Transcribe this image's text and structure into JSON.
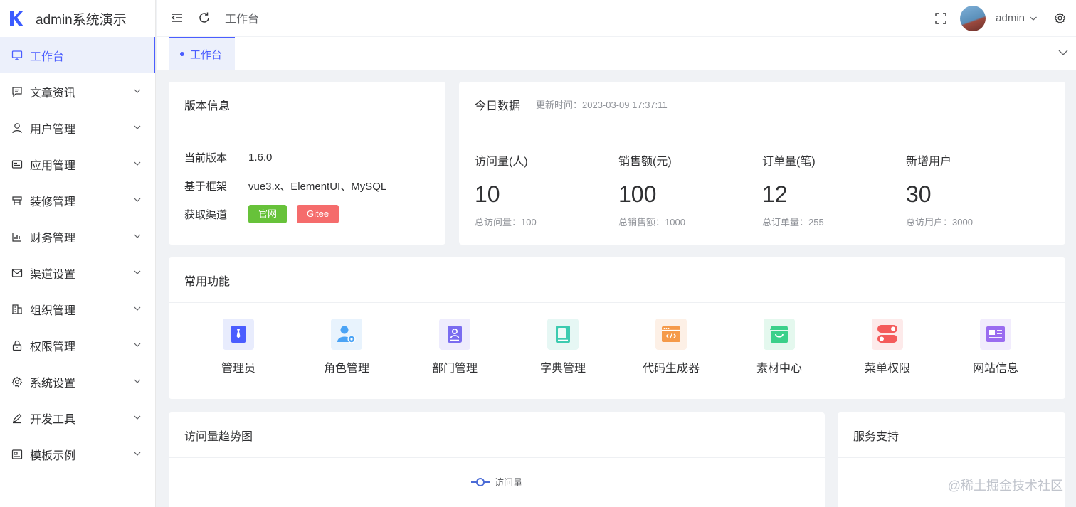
{
  "app": {
    "title": "admin系统演示"
  },
  "sidebar": {
    "items": [
      {
        "label": "工作台",
        "icon": "monitor-icon",
        "active": true
      },
      {
        "label": "文章资讯",
        "icon": "message-icon"
      },
      {
        "label": "用户管理",
        "icon": "user-icon"
      },
      {
        "label": "应用管理",
        "icon": "app-icon"
      },
      {
        "label": "装修管理",
        "icon": "decorate-icon"
      },
      {
        "label": "财务管理",
        "icon": "chart-icon"
      },
      {
        "label": "渠道设置",
        "icon": "mail-icon"
      },
      {
        "label": "组织管理",
        "icon": "building-icon"
      },
      {
        "label": "权限管理",
        "icon": "lock-icon"
      },
      {
        "label": "系统设置",
        "icon": "gear-icon"
      },
      {
        "label": "开发工具",
        "icon": "pen-icon"
      },
      {
        "label": "模板示例",
        "icon": "template-icon"
      }
    ]
  },
  "header": {
    "breadcrumb": "工作台",
    "user": "admin"
  },
  "tabs": [
    {
      "label": "工作台"
    }
  ],
  "version": {
    "title": "版本信息",
    "rows": [
      {
        "k": "当前版本",
        "v": "1.6.0"
      },
      {
        "k": "基于框架",
        "v": "vue3.x、ElementUI、MySQL"
      },
      {
        "k": "获取渠道"
      }
    ],
    "btn_official": "官网",
    "btn_gitee": "Gitee"
  },
  "today": {
    "title": "今日数据",
    "updated": "更新时间：2023-03-09 17:37:11",
    "stats": [
      {
        "label": "访问量(人)",
        "value": "10",
        "sub": "总访问量：100"
      },
      {
        "label": "销售额(元)",
        "value": "100",
        "sub": "总销售额：1000"
      },
      {
        "label": "订单量(笔)",
        "value": "12",
        "sub": "总订单量：255"
      },
      {
        "label": "新增用户",
        "value": "30",
        "sub": "总访用户：3000"
      }
    ]
  },
  "functions": {
    "title": "常用功能",
    "items": [
      {
        "label": "管理员",
        "icon": "admin-icon",
        "bg": "#e8ecfd",
        "fg": "#4a5dff"
      },
      {
        "label": "角色管理",
        "icon": "role-icon",
        "bg": "#e8f3fd",
        "fg": "#4aa3f5"
      },
      {
        "label": "部门管理",
        "icon": "department-icon",
        "bg": "#eeecfd",
        "fg": "#7a6cf0"
      },
      {
        "label": "字典管理",
        "icon": "dictionary-icon",
        "bg": "#e6f7f4",
        "fg": "#3ccbb0"
      },
      {
        "label": "代码生成器",
        "icon": "code-icon",
        "bg": "#fdf0e6",
        "fg": "#f59a4a"
      },
      {
        "label": "素材中心",
        "icon": "material-icon",
        "bg": "#e4f8ee",
        "fg": "#3bd08a"
      },
      {
        "label": "菜单权限",
        "icon": "menu-permission-icon",
        "bg": "#fdeaea",
        "fg": "#f45b5b"
      },
      {
        "label": "网站信息",
        "icon": "website-icon",
        "bg": "#f1ecfd",
        "fg": "#9a6cf0"
      }
    ]
  },
  "trend": {
    "title": "访问量趋势图",
    "legend": "访问量"
  },
  "support": {
    "title": "服务支持"
  },
  "watermark": "@稀土掘金技术社区",
  "colors": {
    "accent": "#4a5dff",
    "green": "#67c23a",
    "red": "#f56c6c"
  }
}
